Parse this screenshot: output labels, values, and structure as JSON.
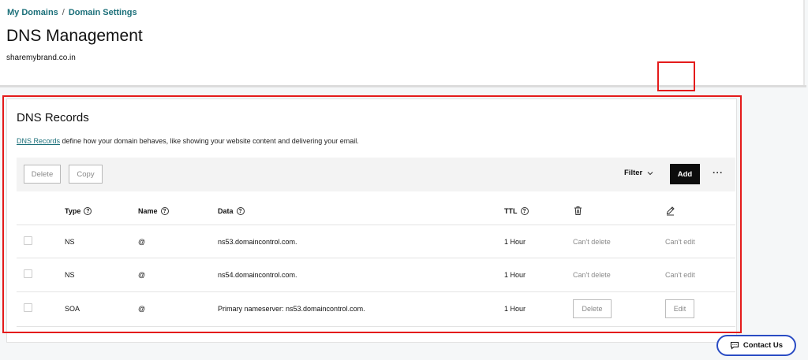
{
  "breadcrumb": {
    "items": [
      "My Domains",
      "Domain Settings"
    ],
    "separator": "/"
  },
  "page": {
    "title": "DNS Management",
    "domain": "sharemybrand.co.in"
  },
  "records": {
    "title": "DNS Records",
    "desc_link": "DNS Records",
    "desc_text": " define how your domain behaves, like showing your website content and delivering your email.",
    "toolbar": {
      "delete": "Delete",
      "copy": "Copy",
      "filter": "Filter",
      "add": "Add",
      "more": "···"
    },
    "columns": {
      "type": "Type",
      "name": "Name",
      "data": "Data",
      "ttl": "TTL",
      "help": "?"
    },
    "rows": [
      {
        "type": "NS",
        "name": "@",
        "data": "ns53.domaincontrol.com.",
        "ttl": "1 Hour",
        "delete": "Can't delete",
        "edit": "Can't edit"
      },
      {
        "type": "NS",
        "name": "@",
        "data": "ns54.domaincontrol.com.",
        "ttl": "1 Hour",
        "delete": "Can't delete",
        "edit": "Can't edit"
      },
      {
        "type": "SOA",
        "name": "@",
        "data": "Primary nameserver: ns53.domaincontrol.com.",
        "ttl": "1 Hour",
        "delete": "Delete",
        "edit": "Edit"
      }
    ]
  },
  "contact": {
    "label": "Contact Us"
  },
  "colors": {
    "accent": "#1b6f79",
    "highlight": "#e41b1b",
    "contact_border": "#2a4cc4",
    "primary_button": "#0c0c0c"
  }
}
